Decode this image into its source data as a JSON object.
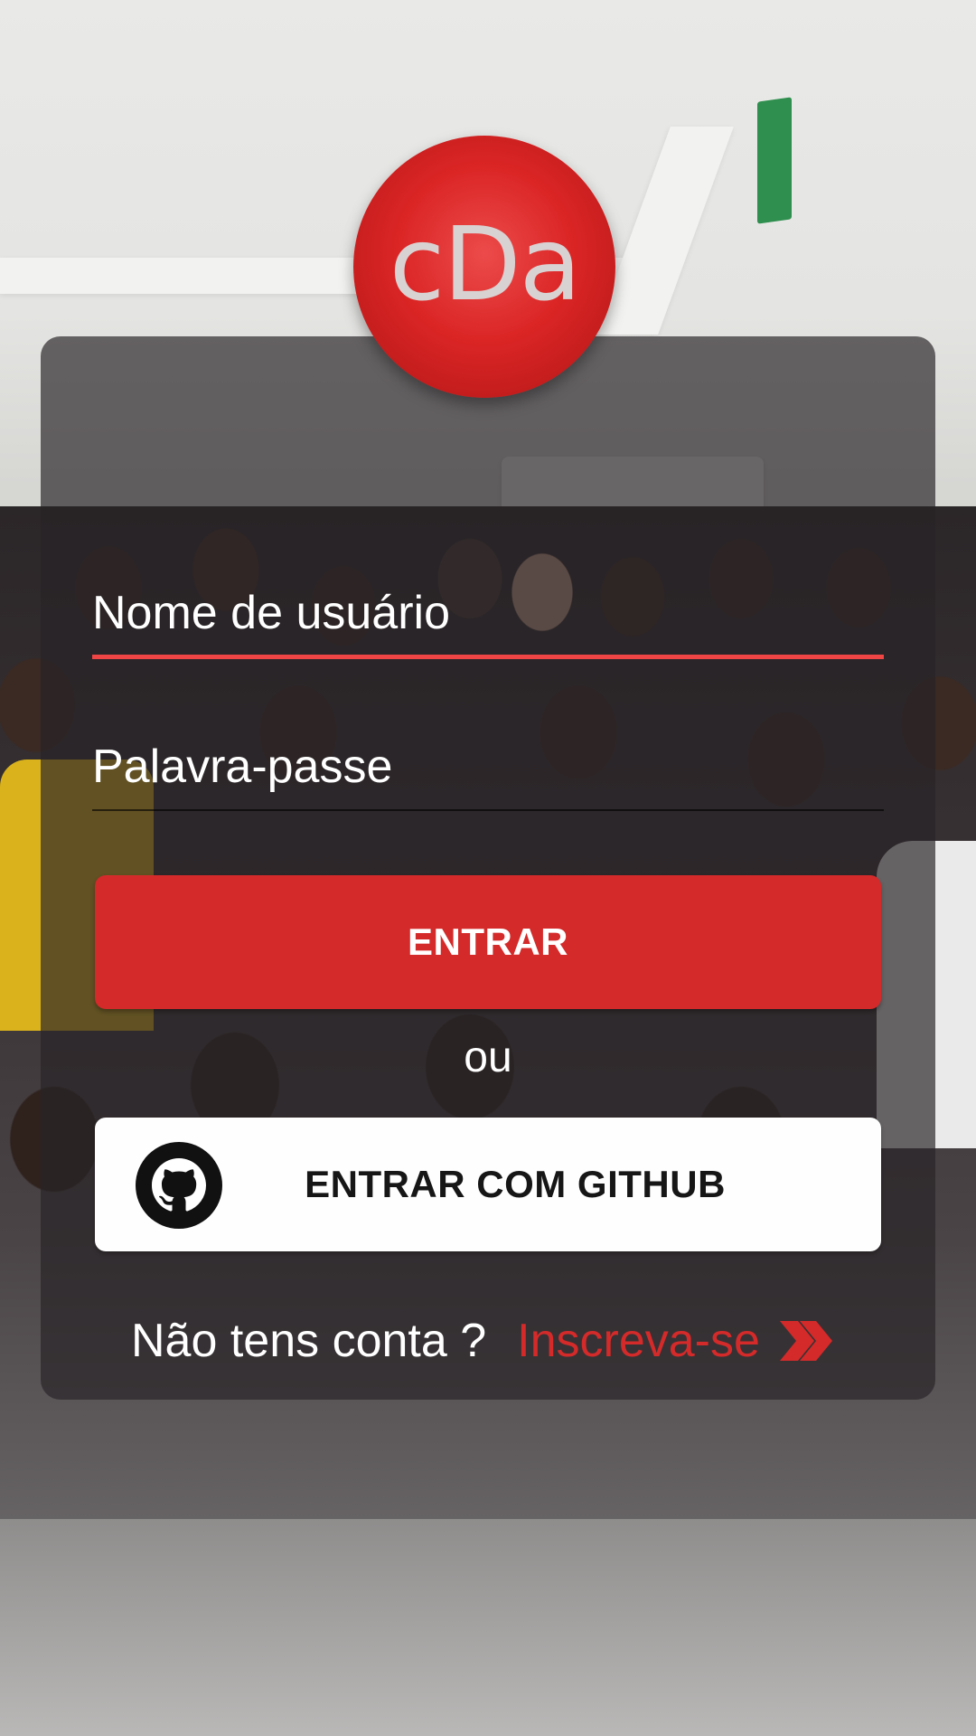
{
  "logo": {
    "text": "cDa"
  },
  "form": {
    "username_placeholder": "Nome de usuário",
    "password_placeholder": "Palavra-passe",
    "login_label": "ENTRAR",
    "or_label": "ou",
    "github_label": "ENTRAR COM GITHUB"
  },
  "signup": {
    "question": "Não tens conta ?",
    "link_label": "Inscreva-se"
  },
  "icons": {
    "github": "github-icon",
    "chevron": "double-chevron-right-icon"
  },
  "colors": {
    "accent": "#d42a2a",
    "active_underline": "#ef4545",
    "card_background": "rgba(40,36,38,0.68)"
  }
}
